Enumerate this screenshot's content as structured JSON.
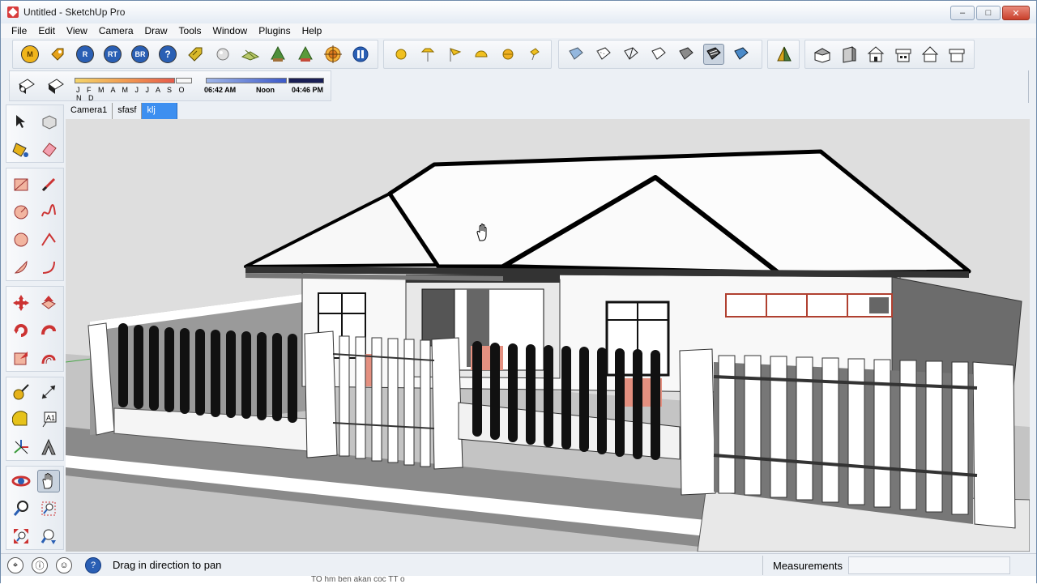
{
  "window": {
    "title": "Untitled - SketchUp Pro",
    "controls": {
      "minimize": "–",
      "maximize": "□",
      "close": "✕"
    }
  },
  "menu": [
    "File",
    "Edit",
    "View",
    "Camera",
    "Draw",
    "Tools",
    "Window",
    "Plugins",
    "Help"
  ],
  "toolbar_plugins": [
    {
      "icon": "m-icon",
      "label": "M",
      "color": "#f0b51c"
    },
    {
      "icon": "tag-icon",
      "label": "",
      "color": "#e6a21a"
    },
    {
      "icon": "r-icon",
      "label": "R",
      "color": "#2a5fb4"
    },
    {
      "icon": "rt-icon",
      "label": "RT",
      "color": "#2a5fb4"
    },
    {
      "icon": "br-icon",
      "label": "BR",
      "color": "#2a5fb4"
    },
    {
      "icon": "help-icon",
      "label": "?",
      "color": "#2a5fb4"
    },
    {
      "icon": "label-tag-icon",
      "label": "",
      "color": "#d9b92a"
    },
    {
      "icon": "sphere-icon",
      "label": "",
      "color": "#c8c8c8"
    },
    {
      "icon": "plane-icon",
      "label": "",
      "color": "#8fa93b"
    },
    {
      "icon": "plant-icon",
      "label": "",
      "color": "#4d8f3b"
    },
    {
      "icon": "plant2-icon",
      "label": "",
      "color": "#c44b3a"
    },
    {
      "icon": "target-icon",
      "label": "",
      "color": "#e07a1d"
    },
    {
      "icon": "pause-icon",
      "label": "",
      "color": "#2a5fb4"
    }
  ],
  "toolbar_lights": [
    "sun-icon",
    "spotlight-icon",
    "flag-icon",
    "dome-light-icon",
    "omni-light-icon",
    "pin-light-icon"
  ],
  "toolbar_styles": [
    "xray-icon",
    "back-edges-icon",
    "wireframe-icon",
    "hidden-line-icon",
    "shaded-icon",
    "shaded-textures-icon",
    "monochrome-icon"
  ],
  "toolbar_section": [
    "section-plane-icon"
  ],
  "toolbar_views": [
    "iso-view-icon",
    "top-view-icon",
    "front-view-icon",
    "right-view-icon",
    "back-view-icon",
    "left-view-icon"
  ],
  "shadows": {
    "months": "J F M A M J J A S O N D",
    "time_start": "06:42 AM",
    "time_mid": "Noon",
    "time_end": "04:46 PM"
  },
  "scene_tabs": [
    "Camera1",
    "sfasf",
    "klj"
  ],
  "active_scene": "klj",
  "left_tools": [
    "select-icon",
    "make-component-icon",
    "paint-bucket-icon",
    "eraser-icon",
    "rectangle-icon",
    "line-icon",
    "circle-icon",
    "freehand-icon",
    "polygon-icon",
    "arc-icon",
    "pie-icon",
    "two-point-arc-icon",
    "move-icon",
    "push-pull-icon",
    "rotate-icon",
    "follow-me-icon",
    "scale-icon",
    "offset-icon",
    "tape-measure-icon",
    "dimension-icon",
    "protractor-icon",
    "text-icon",
    "axes-icon",
    "3d-text-icon",
    "orbit-icon",
    "pan-icon",
    "zoom-icon",
    "zoom-window-icon",
    "zoom-extents-icon",
    "previous-view-icon"
  ],
  "status": {
    "hint": "Drag in direction to pan",
    "measurements_label": "Measurements",
    "measurements_value": "",
    "bottom_caption": "TO hm ben akan coc TT o"
  }
}
